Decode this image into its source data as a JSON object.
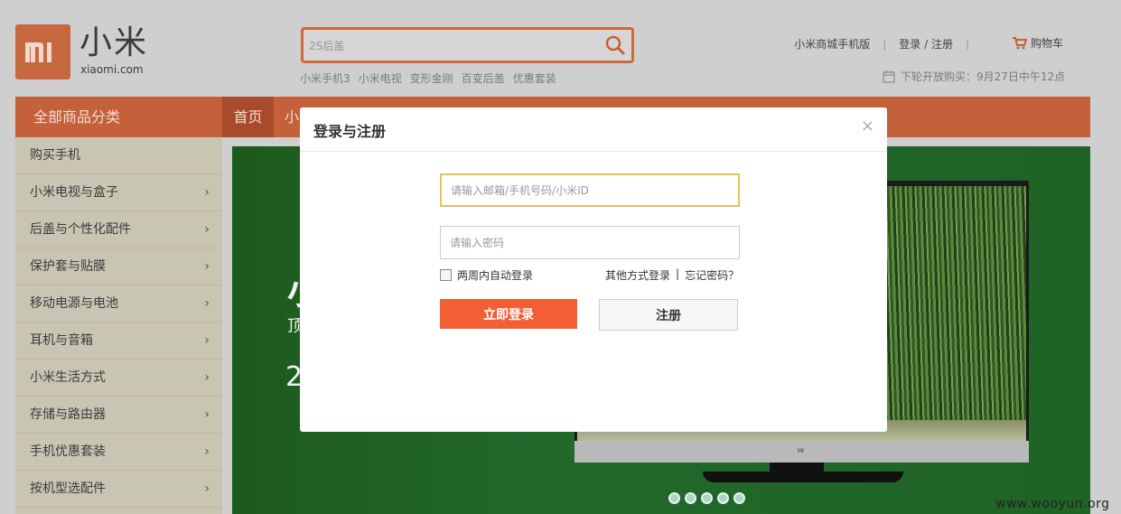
{
  "header": {
    "logo_text": "小米",
    "logo_sub": "xiaomi.com",
    "search_placeholder": "2S后盖",
    "hot_links": [
      "小米手机3",
      "小米电视",
      "变形金刚",
      "百变后盖",
      "优惠套装"
    ],
    "top_links": [
      "小米商城手机版",
      "登录 / 注册"
    ],
    "cart_label": "购物车",
    "notice": "下轮开放购买：9月27日中午12点"
  },
  "nav": {
    "all_categories": "全部商品分类",
    "home": "首页",
    "next_partial": "小"
  },
  "sidebar": {
    "items": [
      {
        "label": "购买手机",
        "arrow": ""
      },
      {
        "label": "小米电视与盒子",
        "arrow": "›"
      },
      {
        "label": "后盖与个性化配件",
        "arrow": "›"
      },
      {
        "label": "保护套与贴膜",
        "arrow": "›"
      },
      {
        "label": "移动电源与电池",
        "arrow": "›"
      },
      {
        "label": "耳机与音箱",
        "arrow": "›"
      },
      {
        "label": "小米生活方式",
        "arrow": "›"
      },
      {
        "label": "存储与路由器",
        "arrow": "›"
      },
      {
        "label": "手机优惠套装",
        "arrow": "›"
      },
      {
        "label": "按机型选配件",
        "arrow": "›"
      }
    ]
  },
  "banner": {
    "text1": "小",
    "text2": "顶",
    "text3": "2",
    "tv_logo": "MI",
    "carousel_dot_count": 5
  },
  "modal": {
    "title": "登录与注册",
    "close": "×",
    "account_placeholder": "请输入邮箱/手机号码/小米ID",
    "password_placeholder": "请输入密码",
    "remember_label": "两周内自动登录",
    "other_login": "其他方式登录",
    "separator": "|",
    "forgot": "忘记密码？",
    "login_button": "立即登录",
    "register_button": "注册"
  },
  "watermark": "www.wooyun.org",
  "colors": {
    "brand_orange": "#f25f34",
    "nav_bg": "#c4603a",
    "focus_border": "#e6c25a"
  }
}
